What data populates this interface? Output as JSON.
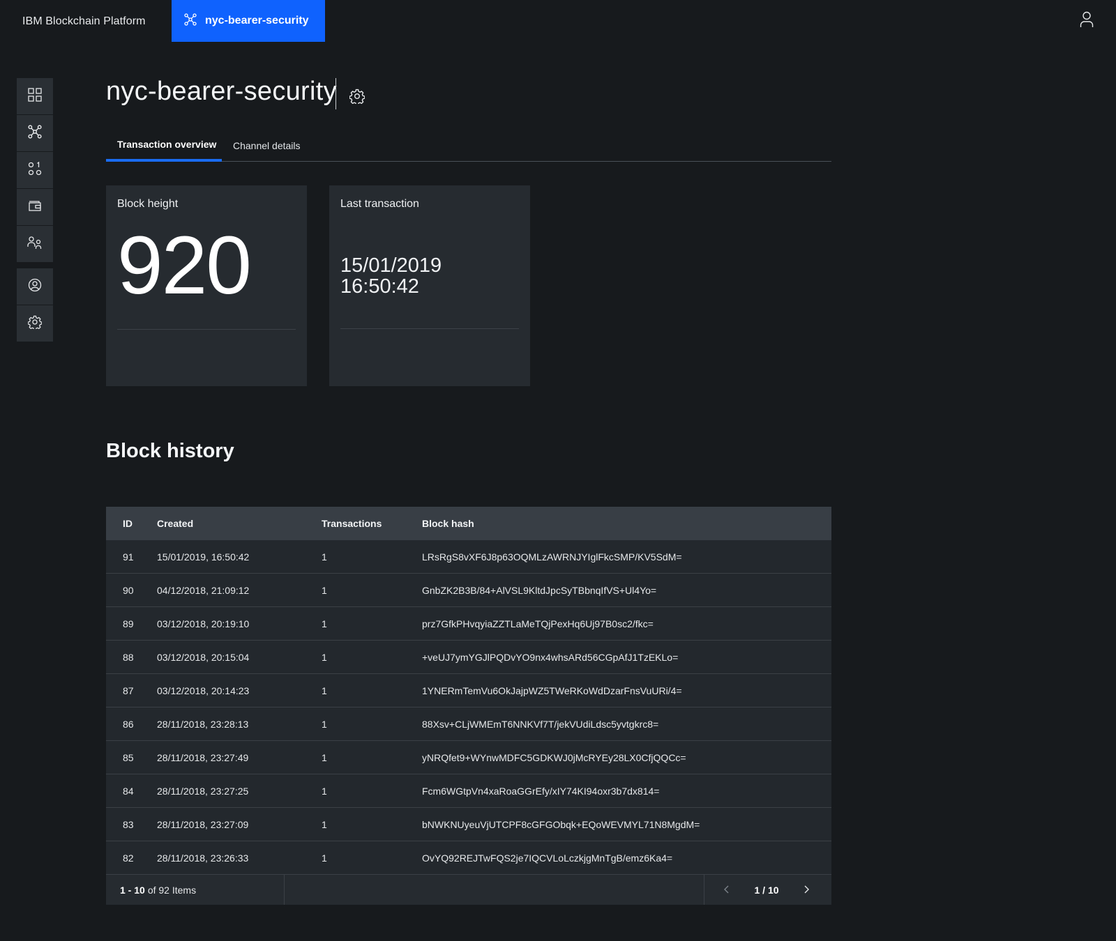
{
  "header": {
    "brand": "IBM Blockchain Platform",
    "active_tab_label": "nyc-bearer-security"
  },
  "sidebar": {
    "items": [
      {
        "icon": "dashboard-grid-icon"
      },
      {
        "icon": "channel-network-icon"
      },
      {
        "icon": "smart-contracts-icon"
      },
      {
        "icon": "wallet-icon"
      },
      {
        "icon": "organizations-icon"
      },
      {
        "icon": "user-profile-icon"
      },
      {
        "icon": "settings-gear-icon"
      }
    ]
  },
  "page": {
    "title": "nyc-bearer-security",
    "tabs": [
      "Transaction overview",
      "Channel details"
    ]
  },
  "tiles": {
    "block_height": {
      "label": "Block height",
      "value": "920"
    },
    "last_transaction": {
      "label": "Last transaction",
      "date": "15/01/2019",
      "time": "16:50:42"
    }
  },
  "block_history": {
    "title": "Block history",
    "columns": [
      "ID",
      "Created",
      "Transactions",
      "Block hash"
    ],
    "rows": [
      {
        "id": "91",
        "created": "15/01/2019, 16:50:42",
        "tx": "1",
        "hash": "LRsRgS8vXF6J8p63OQMLzAWRNJYIglFkcSMP/KV5SdM="
      },
      {
        "id": "90",
        "created": "04/12/2018, 21:09:12",
        "tx": "1",
        "hash": "GnbZK2B3B/84+AlVSL9KltdJpcSyTBbnqIfVS+Ul4Yo="
      },
      {
        "id": "89",
        "created": "03/12/2018, 20:19:10",
        "tx": "1",
        "hash": "prz7GfkPHvqyiaZZTLaMeTQjPexHq6Uj97B0sc2/fkc="
      },
      {
        "id": "88",
        "created": "03/12/2018, 20:15:04",
        "tx": "1",
        "hash": "+veUJ7ymYGJlPQDvYO9nx4whsARd56CGpAfJ1TzEKLo="
      },
      {
        "id": "87",
        "created": "03/12/2018, 20:14:23",
        "tx": "1",
        "hash": "1YNERmTemVu6OkJajpWZ5TWeRKoWdDzarFnsVuURi/4="
      },
      {
        "id": "86",
        "created": "28/11/2018, 23:28:13",
        "tx": "1",
        "hash": "88Xsv+CLjWMEmT6NNKVf7T/jekVUdiLdsc5yvtgkrc8="
      },
      {
        "id": "85",
        "created": "28/11/2018, 23:27:49",
        "tx": "1",
        "hash": "yNRQfet9+WYnwMDFC5GDKWJ0jMcRYEy28LX0CfjQQCc="
      },
      {
        "id": "84",
        "created": "28/11/2018, 23:27:25",
        "tx": "1",
        "hash": "Fcm6WGtpVn4xaRoaGGrEfy/xIY74KI94oxr3b7dx814="
      },
      {
        "id": "83",
        "created": "28/11/2018, 23:27:09",
        "tx": "1",
        "hash": "bNWKNUyeuVjUTCPF8cGFGObqk+EQoWEVMYL71N8MgdM="
      },
      {
        "id": "82",
        "created": "28/11/2018, 23:26:33",
        "tx": "1",
        "hash": "OvYQ92REJTwFQS2je7IQCVLoLczkjgMnTgB/emz6Ka4="
      }
    ],
    "footer": {
      "range": "1 - 10",
      "of_text": "of 92 Items",
      "page": "1 / 10"
    }
  },
  "colors": {
    "accent": "#0f62fe",
    "background": "#171a1d",
    "tile": "#262b30"
  }
}
